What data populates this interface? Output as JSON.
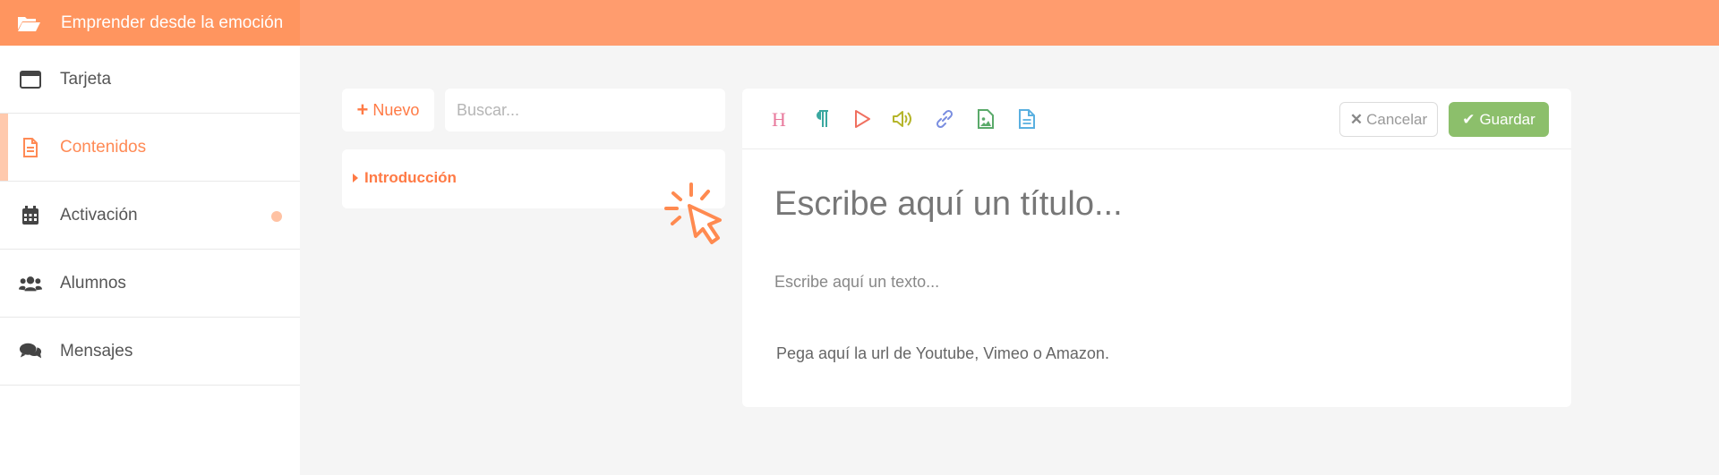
{
  "header": {
    "title": "Emprender desde la emoción",
    "icon": "folder-open-icon"
  },
  "sidebar": {
    "items": [
      {
        "label": "Tarjeta",
        "icon": "window-icon",
        "active": false
      },
      {
        "label": "Contenidos",
        "icon": "document-icon",
        "active": true
      },
      {
        "label": "Activación",
        "icon": "calendar-icon",
        "active": false,
        "has_dot": true
      },
      {
        "label": "Alumnos",
        "icon": "users-icon",
        "active": false
      },
      {
        "label": "Mensajes",
        "icon": "chat-icon",
        "active": false
      }
    ]
  },
  "list_panel": {
    "new_button_label": "Nuevo",
    "search_placeholder": "Buscar...",
    "items": [
      {
        "label": "Introducción"
      }
    ]
  },
  "editor": {
    "tools": [
      "heading-icon",
      "paragraph-icon",
      "video-play-icon",
      "audio-icon",
      "link-icon",
      "image-file-icon",
      "text-file-icon"
    ],
    "cancel_label": "Cancelar",
    "save_label": "Guardar",
    "title_placeholder": "Escribe aquí un título...",
    "text_placeholder": "Escribe aquí un texto...",
    "url_placeholder": "Pega aquí la url de Youtube, Vimeo o Amazon."
  },
  "colors": {
    "topbar": "#ff9c6e",
    "accent": "#ff7a45",
    "save": "#8cbf6b",
    "background": "#f5f5f5"
  }
}
